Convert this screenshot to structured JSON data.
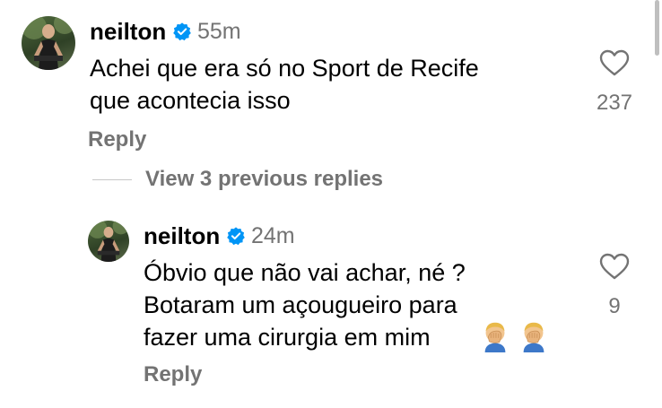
{
  "comment": {
    "username": "neilton",
    "time": "55m",
    "lines": [
      "Achei que era só no Sport de Recife",
      "que acontecia isso"
    ],
    "likes": "237",
    "reply_label": "Reply"
  },
  "view_previous_replies": "View 3 previous replies",
  "reply": {
    "username": "neilton",
    "time": "24m",
    "lines": [
      "Óbvio que não vai achar, né ?",
      "Botaram um açougueiro para",
      "fazer uma cirurgia em mim"
    ],
    "emojis": [
      "face-palm-emoji",
      "face-palm-emoji"
    ],
    "likes": "9",
    "reply_label": "Reply"
  },
  "colors": {
    "text": "#000000",
    "secondary": "#737373",
    "verified": "#0095f6"
  }
}
